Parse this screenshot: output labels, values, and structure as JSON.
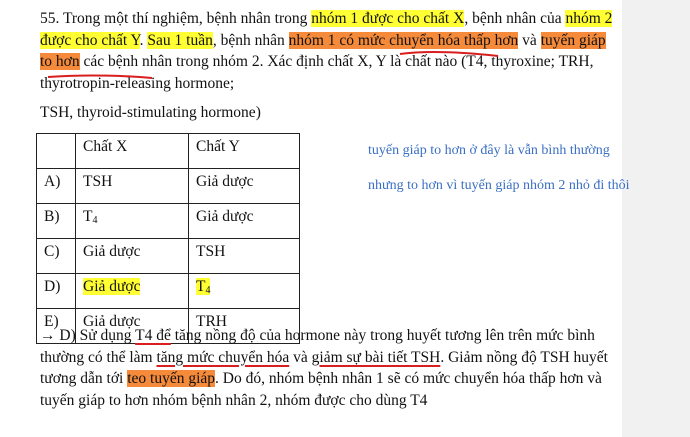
{
  "question": {
    "p1_a": "55. Trong một thí nghiệm, bệnh nhân trong ",
    "p1_hl1": "nhóm 1 được cho chất X",
    "p1_b": ", bệnh nhân của ",
    "p1_hl2": "nhóm 2 được cho chất Y",
    "p1_c": ". ",
    "p1_hl3": "Sau 1 tuần",
    "p1_d": ", bệnh nhân ",
    "p1_hl4": "nhóm 1 có mức chuyển hóa thấp hơn",
    "p1_e": " và ",
    "p1_hl5": "tuyến giáp to hơn",
    "p1_f": " các bệnh nhân trong nhóm 2. Xác định chất X, Y là chất nào (T4, thyroxine; TRH, thyrotropin-releasing hormone;",
    "p2": "TSH, thyroid-stimulating hormone)"
  },
  "table": {
    "header": [
      "",
      "Chất X",
      "Chất Y"
    ],
    "rows": [
      {
        "label": "A)",
        "x": "TSH",
        "y": "Giả dược"
      },
      {
        "label": "B)",
        "x": "T",
        "x_sub": "4",
        "y": "Giả dược"
      },
      {
        "label": "C)",
        "x": "Giả dược",
        "y": "TSH"
      },
      {
        "label": "D)",
        "x": "Giả dược",
        "y": "T",
        "y_sub": "4"
      },
      {
        "label": "E)",
        "x": "Giả dược",
        "y": "TRH"
      }
    ]
  },
  "notes": {
    "line1": "tuyến giáp to hơn ở đây là vẫn bình thường",
    "line2": "nhưng to hơn vì tuyến giáp nhóm 2 nhỏ đi thôi"
  },
  "answer": {
    "a": "→ D) Sử dụng ",
    "u1": "T4 để",
    "b": " tăng nồng độ của hormone này trong huyết tương lên trên mức bình thường có thể làm ",
    "u2": "tăng mức chuyển hóa",
    "c": " và ",
    "u3": "giảm sự bài tiết TSH",
    "d": ". Giảm nồng độ TSH huyết tương dẫn tới ",
    "hl": "teo tuyến giáp",
    "e": ". Do đó, nhóm bệnh nhân 1 sẽ có mức chuyển hóa thấp hơn và tuyến giáp to hơn nhóm bệnh nhân 2, nhóm được cho dùng T4"
  },
  "colors": {
    "highlight_yellow": "#ffff33",
    "highlight_orange": "#f58a3a",
    "note_blue": "#3a6fc4",
    "pen_red": "#d81e1e"
  }
}
